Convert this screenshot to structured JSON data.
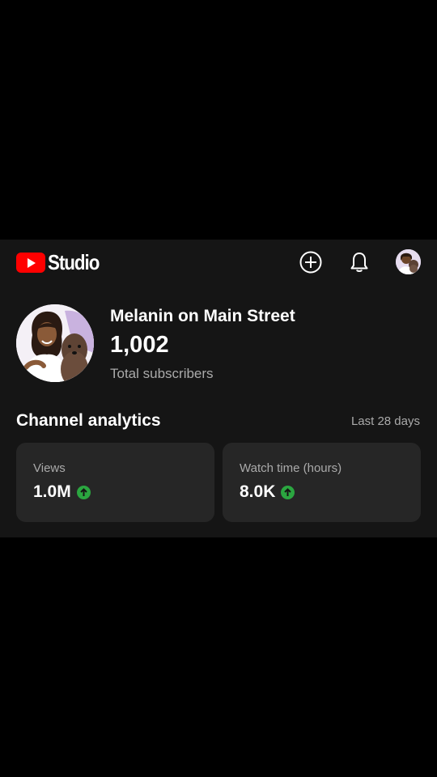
{
  "header": {
    "logo_text": "Studio",
    "icons": [
      "create-icon",
      "notifications-bell-icon",
      "account-avatar"
    ]
  },
  "channel": {
    "name": "Melanin on Main Street",
    "subscriber_count": "1,002",
    "subscriber_label": "Total subscribers"
  },
  "analytics": {
    "title": "Channel analytics",
    "period": "Last 28 days",
    "cards": [
      {
        "label": "Views",
        "value": "1.0M",
        "trend": "up"
      },
      {
        "label": "Watch time (hours)",
        "value": "8.0K",
        "trend": "up"
      }
    ]
  },
  "colors": {
    "brand_red": "#ff0000",
    "trend_up_green": "#2ba640",
    "panel_background": "#151515",
    "card_background": "#262626"
  }
}
